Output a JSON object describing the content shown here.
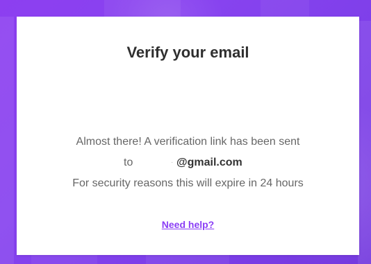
{
  "page": {
    "title": "Verify your email",
    "message_line_1": "Almost there! A verification link has been sent",
    "message_to": "to",
    "masked_email_prefix": "·",
    "email_domain": "@gmail.com",
    "message_line_3": "For security reasons this will expire in 24 hours",
    "help_link": "Need help?"
  },
  "colors": {
    "background_purple": "#8743ef",
    "card_white": "#ffffff",
    "title_text": "#2f2f2f",
    "body_text": "#666666",
    "email_text": "#333333",
    "link_purple": "#8a3ef5"
  }
}
